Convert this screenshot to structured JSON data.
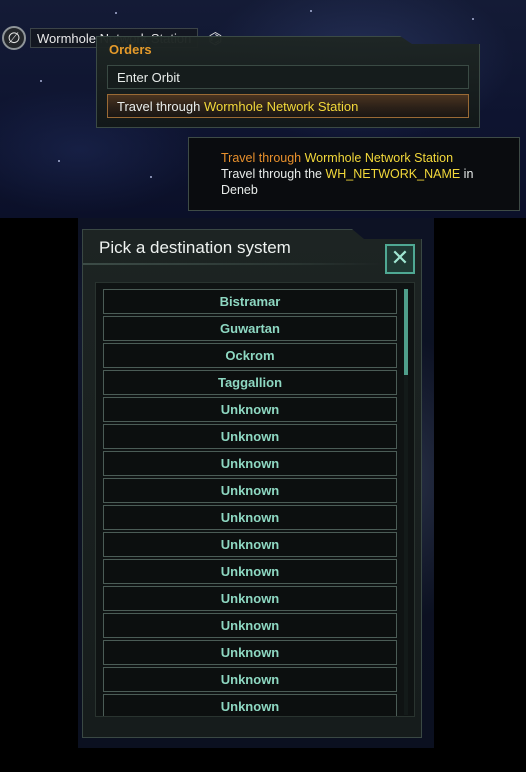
{
  "system": {
    "icon": "empty-set-icon",
    "icon_glyph": "∅",
    "name": "Wormhole Network Station",
    "badge_icon": "network-badge-icon",
    "badge_glyph": "⌬"
  },
  "orders_menu": {
    "title": "Orders",
    "items": [
      {
        "label": "Enter Orbit"
      },
      {
        "prefix": "Travel through ",
        "highlight": "Wormhole Network Station"
      }
    ]
  },
  "tooltip": {
    "title_prefix": "Travel through ",
    "title_highlight": "Wormhole Network Station",
    "body_prefix": "Travel through the ",
    "body_highlight": "WH_NETWORK_NAME",
    "body_suffix": " in",
    "body_line2": "Deneb"
  },
  "picker": {
    "title": "Pick a destination system",
    "close_glyph": "✕",
    "destinations": [
      "Bistramar",
      "Guwartan",
      "Ockrom",
      "Taggallion",
      "Unknown",
      "Unknown",
      "Unknown",
      "Unknown",
      "Unknown",
      "Unknown",
      "Unknown",
      "Unknown",
      "Unknown",
      "Unknown",
      "Unknown",
      "Unknown"
    ],
    "scroll_position": 0
  },
  "colors": {
    "orange": "#e8902c",
    "yellow": "#f2d83a",
    "list_text": "#8ed8c2",
    "accent": "#4fa893"
  }
}
